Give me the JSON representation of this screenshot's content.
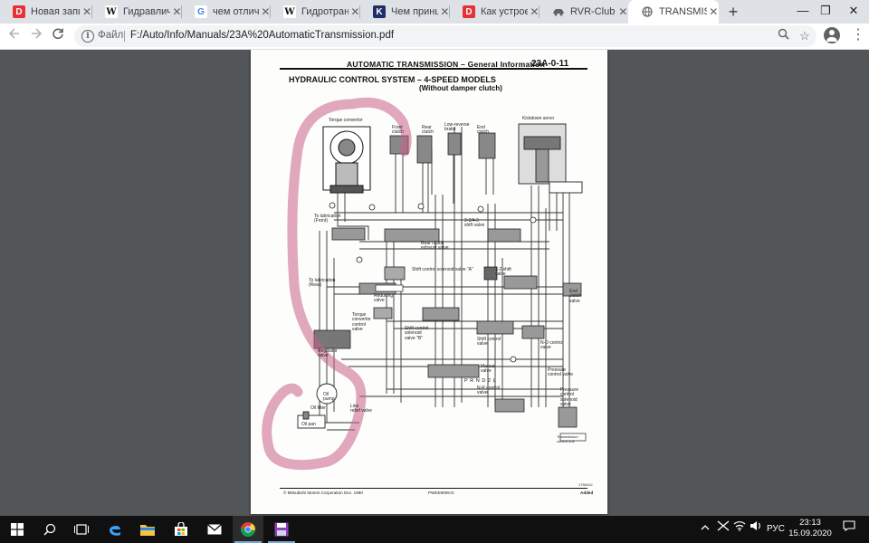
{
  "browser": {
    "tabs": [
      {
        "favicon": "D",
        "favicon_color": "#e63138",
        "label": "Новая запис"
      },
      {
        "favicon": "W",
        "favicon_color": "#ffffff",
        "label": "Гидравличес"
      },
      {
        "favicon": "G",
        "favicon_color": "#ffffff",
        "label": "чем отличае"
      },
      {
        "favicon": "W",
        "favicon_color": "#ffffff",
        "label": "Гидротрансф"
      },
      {
        "favicon": "K",
        "favicon_color": "#1f2f66",
        "label": "Чем принцип"
      },
      {
        "favicon": "D",
        "favicon_color": "#e63138",
        "label": "Как устроен"
      },
      {
        "favicon": "car-icon",
        "favicon_color": "#5f6368",
        "label": "RVR-Club - Ф"
      },
      {
        "favicon": "globe-icon",
        "favicon_color": "#5f6368",
        "label": "TRANSMISSI"
      }
    ],
    "active_tab": 7,
    "window_controls": {
      "minimize": "—",
      "restore": "❐",
      "close": "✕"
    },
    "address": {
      "scheme_label": "Файл",
      "url": "F:/Auto/Info/Manuals/23A%20AutomaticTransmission.pdf"
    }
  },
  "pdf_page": {
    "header_title": "AUTOMATIC TRANSMISSION – General Information",
    "page_code": "23A-0-11",
    "title_line1": "HYDRAULIC CONTROL SYSTEM – 4-SPEED MODELS",
    "title_line2": "(Without damper clutch)",
    "labels": {
      "torque_convertor": "Torque convertor",
      "front_clutch": "Front\nclutch",
      "rear_clutch": "Rear\nclutch",
      "low_reverse_brake": "Low-reverse\nbrake",
      "end_clutch": "End\nclutch",
      "kickdown_servo": "Kickdown servo",
      "to_lubrication_front": "To lubrication\n(Front)",
      "to_lubrication_rear": "To lubrication\n(Rear)",
      "shift_valve_234": "2-3/4-3\nshift valve",
      "rear_clutch_exhaust": "Rear clutch\nexhaust valve",
      "shift_solenoid_a": "Shift control solenoid valve \"A\"",
      "shift_valve_12": "1-2 shift\nvalve",
      "end_clutch_valve": "End\nclutch\nvalve",
      "reducing_valve": "Reducing\nvalve",
      "torque_converter_control": "Torque\nconvertor\ncontrol\nvalve",
      "shift_solenoid_b": "Shift control\nsolenoid\nvalve \"B\"",
      "shift_control_valve": "Shift control\nvalve",
      "nd_control_valve": "N-D control\nvalve",
      "regulator_valve": "Regulator\nvalve",
      "manual_valve": "Manual\nvalve",
      "pressure_control_valve": "Pressure\ncontrol valve",
      "prnd": "P R N D 2 L",
      "nr_control_valve": "N-R control\nvalve",
      "pressure_control_solenoid": "Pressure\ncontrol\nsolenoid\nvalve",
      "oil_pump": "Oil\npump",
      "oil_filter": "Oil filter",
      "line_relief_valve": "Line\nrelief valve",
      "oil_pan": "Oil pan",
      "transmission_control_unit": "Transmission\ncontrol unit",
      "figure_id": "1750412"
    },
    "footer": {
      "copyright": "© Mitsubishi Motors Corporation   Dec. 1990",
      "pub_code": "PWEE9006-D",
      "status": "Added"
    }
  },
  "taskbar": {
    "apps": [
      "start-icon",
      "search-icon",
      "task-view-icon",
      "edge-icon",
      "file-explorer-icon",
      "store-icon",
      "mail-icon",
      "chrome-icon",
      "save-disk-icon"
    ],
    "language": "РУС",
    "time": "23:13",
    "date": "15.09.2020"
  },
  "colors": {
    "tabstrip": "#dee1e6",
    "viewer_bg": "#525659",
    "annotation": "#c8608a",
    "taskbar": "#101010"
  }
}
